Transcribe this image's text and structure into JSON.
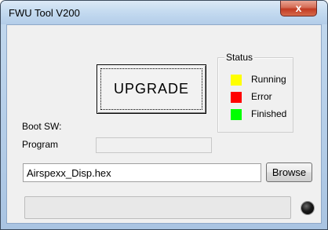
{
  "window": {
    "title": "FWU Tool V200",
    "close_glyph": "x"
  },
  "upgrade_button": {
    "label": "UPGRADE"
  },
  "status": {
    "legend": "Status",
    "items": [
      {
        "label": "Running",
        "color": "#ffff00"
      },
      {
        "label": "Error",
        "color": "#ff0000"
      },
      {
        "label": "Finished",
        "color": "#00ff00"
      }
    ]
  },
  "labels": {
    "boot_sw": "Boot SW:",
    "program": "Program"
  },
  "file": {
    "value": "Airspexx_Disp.hex",
    "browse_label": "Browse"
  },
  "progress": {
    "value": 0
  },
  "indicator": {
    "icon": "led-indicator-icon",
    "state": "off"
  }
}
